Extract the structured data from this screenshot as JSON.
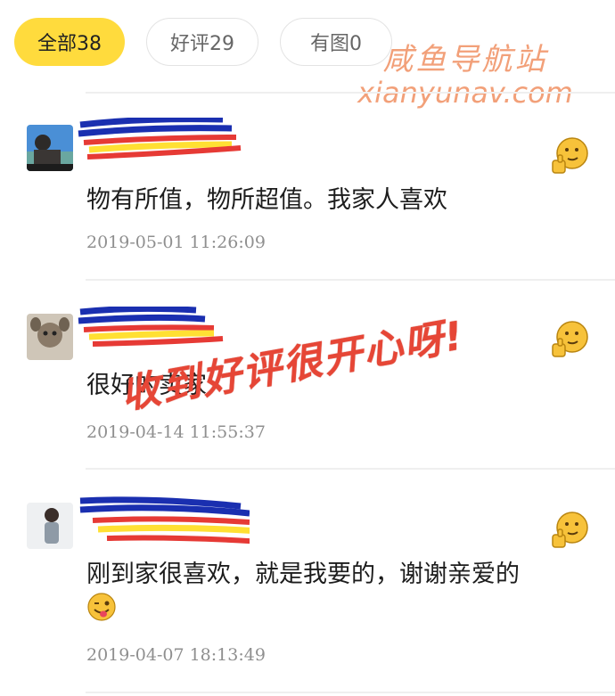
{
  "filters": [
    {
      "label": "全部38",
      "active": true
    },
    {
      "label": "好评29",
      "active": false
    },
    {
      "label": "有图0",
      "active": false
    }
  ],
  "watermark": {
    "title": "咸鱼导航站",
    "url": "xianyunav.com"
  },
  "reviews": [
    {
      "text": "物有所值，物所超值。我家人喜欢",
      "time": "2019-05-01 11:26:09",
      "like_icon": "thumbs-up-emoji-icon"
    },
    {
      "text": "很好的卖家",
      "time": "2019-04-14 11:55:37",
      "like_icon": "thumbs-up-emoji-icon"
    },
    {
      "text": "刚到家很喜欢，就是我要的，谢谢亲爱的",
      "time": "2019-04-07 18:13:49",
      "like_icon": "thumbs-up-emoji-icon",
      "inline_emoji": "winking-tongue-emoji-icon"
    }
  ],
  "stamp": {
    "text": "收到好评很开心呀!"
  },
  "colors": {
    "active_pill": "#ffdb3d",
    "watermark": "#f2a079",
    "stamp": "#e64636",
    "scribble": [
      "#1a2fb0",
      "#e63a35",
      "#ffe033",
      "#ffffff"
    ]
  }
}
